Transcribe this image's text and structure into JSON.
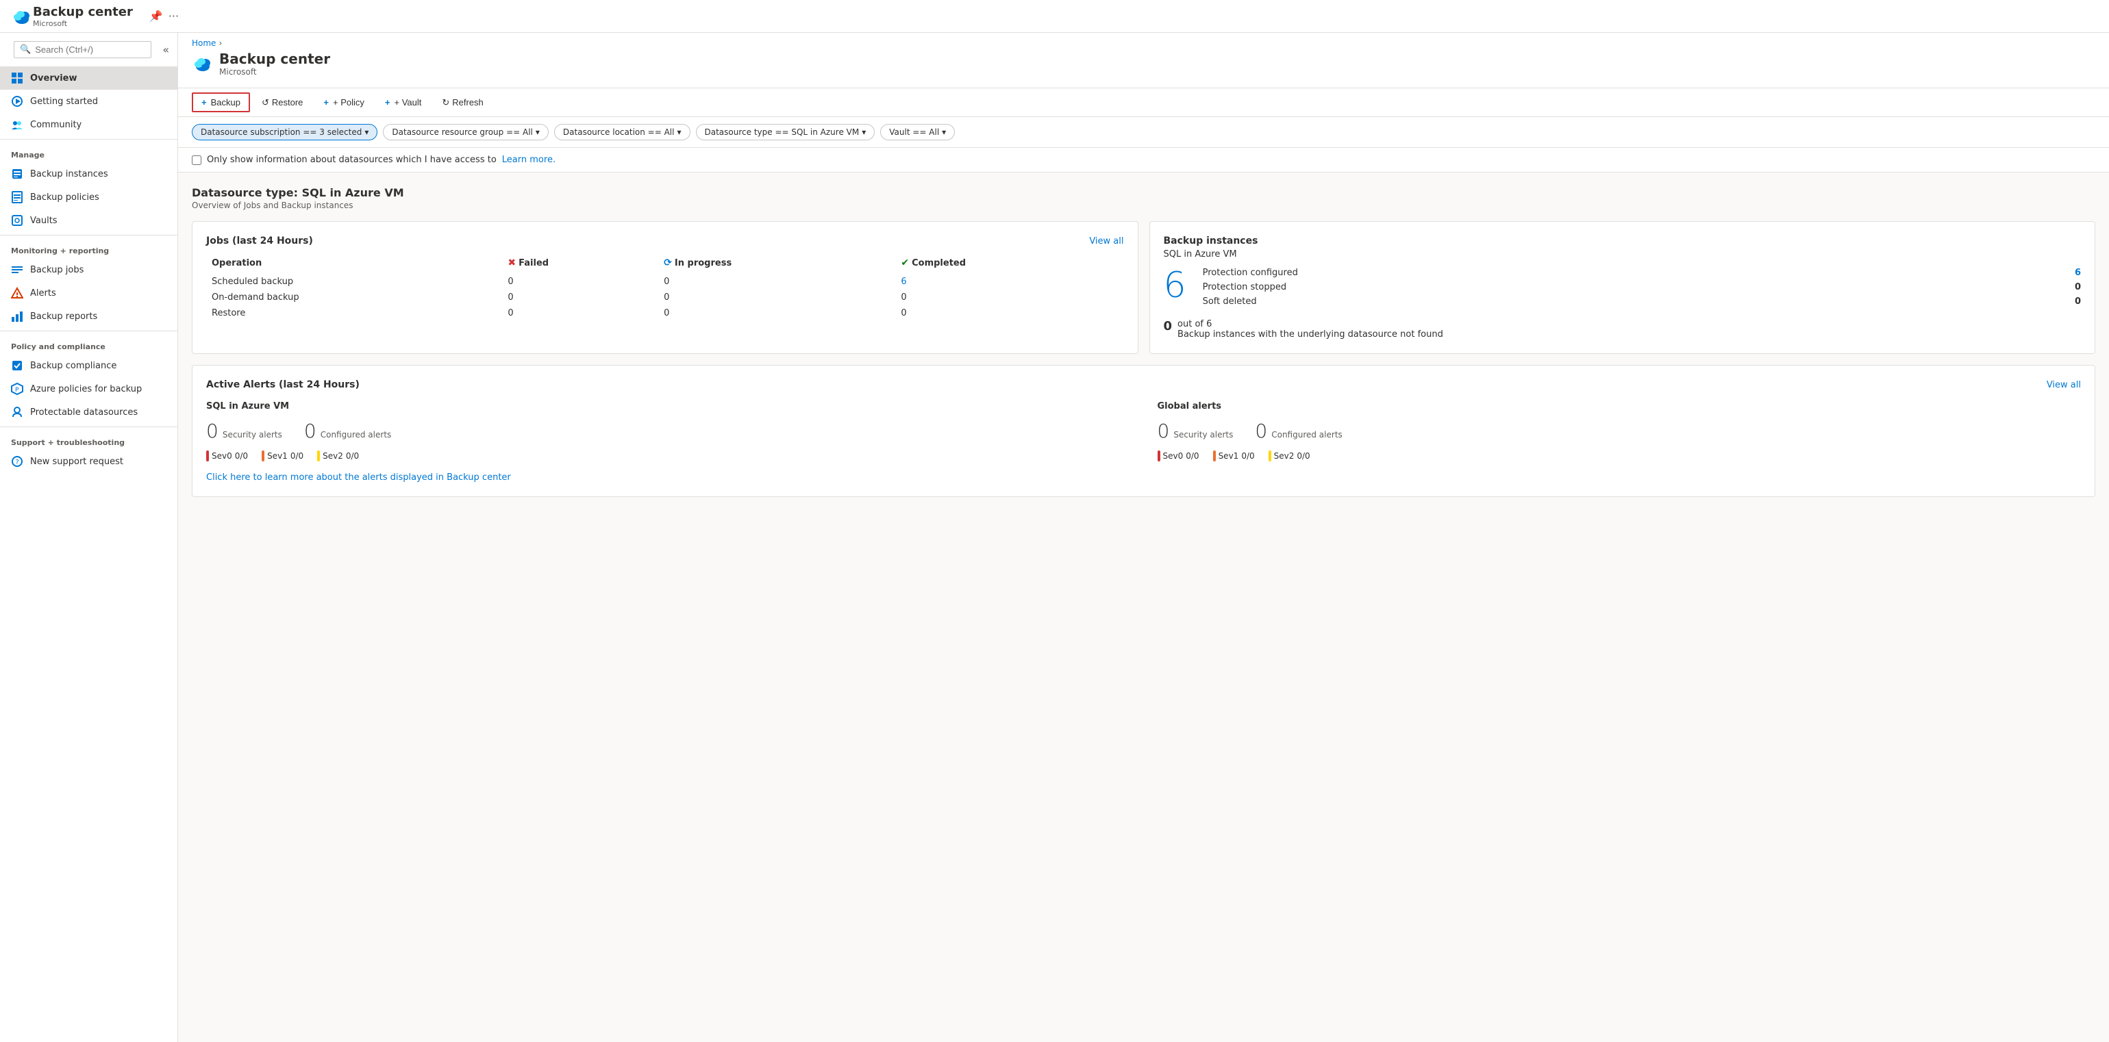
{
  "app": {
    "title": "Backup center",
    "subtitle": "Microsoft",
    "breadcrumb_home": "Home"
  },
  "search": {
    "placeholder": "Search (Ctrl+/)"
  },
  "sidebar": {
    "nav_items": [
      {
        "id": "overview",
        "label": "Overview",
        "icon": "overview",
        "active": true
      },
      {
        "id": "getting-started",
        "label": "Getting started",
        "icon": "start",
        "active": false
      },
      {
        "id": "community",
        "label": "Community",
        "icon": "community",
        "active": false
      }
    ],
    "sections": [
      {
        "label": "Manage",
        "items": [
          {
            "id": "backup-instances",
            "label": "Backup instances",
            "icon": "instances"
          },
          {
            "id": "backup-policies",
            "label": "Backup policies",
            "icon": "policies"
          },
          {
            "id": "vaults",
            "label": "Vaults",
            "icon": "vaults"
          }
        ]
      },
      {
        "label": "Monitoring + reporting",
        "items": [
          {
            "id": "backup-jobs",
            "label": "Backup jobs",
            "icon": "jobs"
          },
          {
            "id": "alerts",
            "label": "Alerts",
            "icon": "alerts"
          },
          {
            "id": "backup-reports",
            "label": "Backup reports",
            "icon": "reports"
          }
        ]
      },
      {
        "label": "Policy and compliance",
        "items": [
          {
            "id": "backup-compliance",
            "label": "Backup compliance",
            "icon": "compliance"
          },
          {
            "id": "azure-policies",
            "label": "Azure policies for backup",
            "icon": "azure-policies"
          },
          {
            "id": "protectable-datasources",
            "label": "Protectable datasources",
            "icon": "datasources"
          }
        ]
      },
      {
        "label": "Support + troubleshooting",
        "items": [
          {
            "id": "new-support",
            "label": "New support request",
            "icon": "support"
          }
        ]
      }
    ]
  },
  "toolbar": {
    "backup_label": "+ Backup",
    "restore_label": "Restore",
    "policy_label": "+ Policy",
    "vault_label": "+ Vault",
    "refresh_label": "Refresh"
  },
  "filters": {
    "chips": [
      {
        "label": "Datasource subscription == 3 selected",
        "active": true
      },
      {
        "label": "Datasource resource group == All",
        "active": false
      },
      {
        "label": "Datasource location == All",
        "active": false
      },
      {
        "label": "Datasource type == SQL in Azure VM",
        "active": false
      },
      {
        "label": "Vault == All",
        "active": false
      }
    ]
  },
  "checkbox_row": {
    "label": "Only show information about datasources which I have access to",
    "learn_more": "Learn more."
  },
  "main": {
    "datasource_title": "Datasource type: SQL in Azure VM",
    "datasource_sub": "Overview of Jobs and Backup instances",
    "jobs_card": {
      "title": "Jobs (last 24 Hours)",
      "view_all": "View all",
      "headers": [
        "Operation",
        "Failed",
        "In progress",
        "Completed"
      ],
      "rows": [
        {
          "operation": "Scheduled backup",
          "failed": "0",
          "in_progress": "0",
          "completed": "6"
        },
        {
          "operation": "On-demand backup",
          "failed": "0",
          "in_progress": "0",
          "completed": "0"
        },
        {
          "operation": "Restore",
          "failed": "0",
          "in_progress": "0",
          "completed": "0"
        }
      ],
      "completed_link_row": 0
    },
    "backup_instances_card": {
      "title": "Backup instances",
      "datasource_label": "SQL in Azure VM",
      "big_count": "6",
      "protection_configured_label": "Protection configured",
      "protection_configured_val": "6",
      "protection_stopped_label": "Protection stopped",
      "protection_stopped_val": "0",
      "soft_deleted_label": "Soft deleted",
      "soft_deleted_val": "0",
      "footer_count": "0",
      "footer_out": "out of 6",
      "footer_desc": "Backup instances with the underlying datasource not found"
    },
    "alerts_card": {
      "title": "Active Alerts (last 24 Hours)",
      "view_all": "View all",
      "sql_col": {
        "title": "SQL in Azure VM",
        "security_alerts_count": "0",
        "security_alerts_label": "Security alerts",
        "configured_alerts_count": "0",
        "configured_alerts_label": "Configured alerts",
        "sev0_label": "Sev0",
        "sev0_val": "0/0",
        "sev1_label": "Sev1",
        "sev1_val": "0/0",
        "sev2_label": "Sev2",
        "sev2_val": "0/0"
      },
      "global_col": {
        "title": "Global alerts",
        "security_alerts_count": "0",
        "security_alerts_label": "Security alerts",
        "configured_alerts_count": "0",
        "configured_alerts_label": "Configured alerts",
        "sev0_label": "Sev0",
        "sev0_val": "0/0",
        "sev1_label": "Sev1",
        "sev1_val": "0/0",
        "sev2_label": "Sev2",
        "sev2_val": "0/0"
      },
      "learn_link": "Click here to learn more about the alerts displayed in Backup center"
    }
  }
}
